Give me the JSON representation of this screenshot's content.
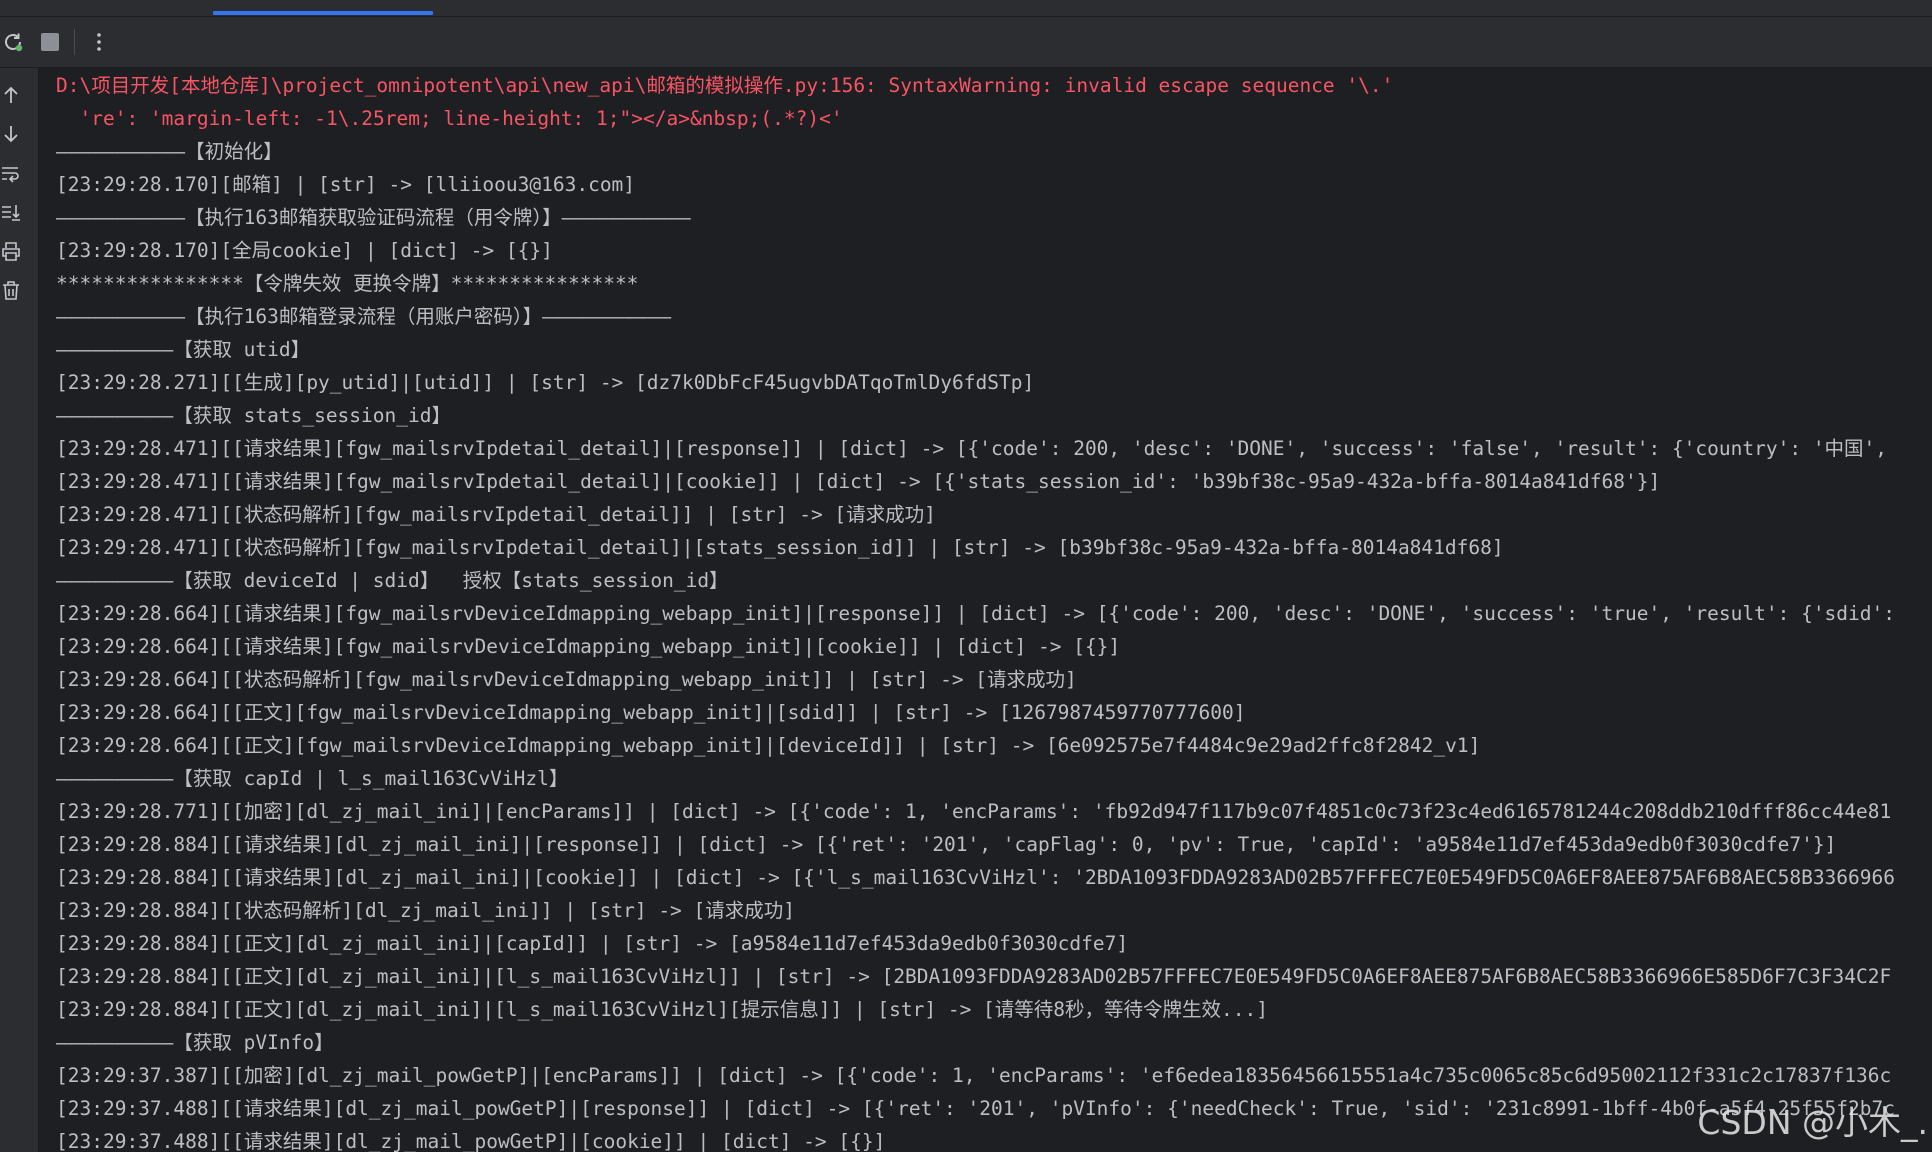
{
  "toolbar": {
    "rerun_icon": "rerun-icon",
    "stop_icon": "stop-icon",
    "more_icon": "more-vertical-icon"
  },
  "gutter": {
    "up_icon": "arrow-up-icon",
    "down_icon": "arrow-down-icon",
    "wrap_icon": "soft-wrap-icon",
    "scroll_end_icon": "scroll-to-end-icon",
    "print_icon": "print-icon",
    "clear_icon": "trash-icon"
  },
  "colors": {
    "background": "#1e1f22",
    "panel": "#2b2d30",
    "text": "#bcbec4",
    "error": "#f75464",
    "accent": "#3574f0"
  },
  "console_lines": [
    {
      "text": "D:\\项目开发[本地仓库]\\project_omnipotent\\api\\new_api\\邮箱的模拟操作.py:156: SyntaxWarning: invalid escape sequence '\\.'",
      "type": "err"
    },
    {
      "text": "  're': 'margin-left: -1\\.25rem; line-height: 1;\"></a>&nbsp;(.*?)<'",
      "type": "err"
    },
    {
      "text": "———————————【初始化】",
      "type": "normal"
    },
    {
      "text": "[23:29:28.170][邮箱] | [str] -> [lliioou3@163.com]",
      "type": "normal"
    },
    {
      "text": "———————————【执行163邮箱获取验证码流程（用令牌）】———————————",
      "type": "normal"
    },
    {
      "text": "[23:29:28.170][全局cookie] | [dict] -> [{}]",
      "type": "normal"
    },
    {
      "text": "****************【令牌失效 更换令牌】****************",
      "type": "normal"
    },
    {
      "text": "———————————【执行163邮箱登录流程（用账户密码）】———————————",
      "type": "normal"
    },
    {
      "text": "——————————【获取 utid】",
      "type": "normal"
    },
    {
      "text": "[23:29:28.271][[生成][py_utid]|[utid]] | [str] -> [dz7k0DbFcF45ugvbDATqoTmlDy6fdSTp]",
      "type": "normal"
    },
    {
      "text": "——————————【获取 stats_session_id】",
      "type": "normal"
    },
    {
      "text": "[23:29:28.471][[请求结果][fgw_mailsrvIpdetail_detail]|[response]] | [dict] -> [{'code': 200, 'desc': 'DONE', 'success': 'false', 'result': {'country': '中国',",
      "type": "normal"
    },
    {
      "text": "[23:29:28.471][[请求结果][fgw_mailsrvIpdetail_detail]|[cookie]] | [dict] -> [{'stats_session_id': 'b39bf38c-95a9-432a-bffa-8014a841df68'}]",
      "type": "normal"
    },
    {
      "text": "[23:29:28.471][[状态码解析][fgw_mailsrvIpdetail_detail]] | [str] -> [请求成功]",
      "type": "normal"
    },
    {
      "text": "[23:29:28.471][[状态码解析][fgw_mailsrvIpdetail_detail]|[stats_session_id]] | [str] -> [b39bf38c-95a9-432a-bffa-8014a841df68]",
      "type": "normal"
    },
    {
      "text": "——————————【获取 deviceId | sdid】  授权【stats_session_id】",
      "type": "normal"
    },
    {
      "text": "[23:29:28.664][[请求结果][fgw_mailsrvDeviceIdmapping_webapp_init]|[response]] | [dict] -> [{'code': 200, 'desc': 'DONE', 'success': 'true', 'result': {'sdid':",
      "type": "normal"
    },
    {
      "text": "[23:29:28.664][[请求结果][fgw_mailsrvDeviceIdmapping_webapp_init]|[cookie]] | [dict] -> [{}]",
      "type": "normal"
    },
    {
      "text": "[23:29:28.664][[状态码解析][fgw_mailsrvDeviceIdmapping_webapp_init]] | [str] -> [请求成功]",
      "type": "normal"
    },
    {
      "text": "[23:29:28.664][[正文][fgw_mailsrvDeviceIdmapping_webapp_init]|[sdid]] | [str] -> [1267987459770777600]",
      "type": "normal"
    },
    {
      "text": "[23:29:28.664][[正文][fgw_mailsrvDeviceIdmapping_webapp_init]|[deviceId]] | [str] -> [6e092575e7f4484c9e29ad2ffc8f2842_v1]",
      "type": "normal"
    },
    {
      "text": "——————————【获取 capId | l_s_mail163CvViHzl】",
      "type": "normal"
    },
    {
      "text": "[23:29:28.771][[加密][dl_zj_mail_ini]|[encParams]] | [dict] -> [{'code': 1, 'encParams': 'fb92d947f117b9c07f4851c0c73f23c4ed6165781244c208ddb210dfff86cc44e81",
      "type": "normal"
    },
    {
      "text": "[23:29:28.884][[请求结果][dl_zj_mail_ini]|[response]] | [dict] -> [{'ret': '201', 'capFlag': 0, 'pv': True, 'capId': 'a9584e11d7ef453da9edb0f3030cdfe7'}]",
      "type": "normal"
    },
    {
      "text": "[23:29:28.884][[请求结果][dl_zj_mail_ini]|[cookie]] | [dict] -> [{'l_s_mail163CvViHzl': '2BDA1093FDDA9283AD02B57FFFEC7E0E549FD5C0A6EF8AEE875AF6B8AEC58B3366966",
      "type": "normal"
    },
    {
      "text": "[23:29:28.884][[状态码解析][dl_zj_mail_ini]] | [str] -> [请求成功]",
      "type": "normal"
    },
    {
      "text": "[23:29:28.884][[正文][dl_zj_mail_ini]|[capId]] | [str] -> [a9584e11d7ef453da9edb0f3030cdfe7]",
      "type": "normal"
    },
    {
      "text": "[23:29:28.884][[正文][dl_zj_mail_ini]|[l_s_mail163CvViHzl]] | [str] -> [2BDA1093FDDA9283AD02B57FFFEC7E0E549FD5C0A6EF8AEE875AF6B8AEC58B3366966E585D6F7C3F34C2F",
      "type": "normal"
    },
    {
      "text": "[23:29:28.884][[正文][dl_zj_mail_ini]|[l_s_mail163CvViHzl][提示信息]] | [str] -> [请等待8秒，等待令牌生效...]",
      "type": "normal"
    },
    {
      "text": "——————————【获取 pVInfo】",
      "type": "normal"
    },
    {
      "text": "[23:29:37.387][[加密][dl_zj_mail_powGetP]|[encParams]] | [dict] -> [{'code': 1, 'encParams': 'ef6edea18356456615551a4c735c0065c85c6d95002112f331c2c17837f136c",
      "type": "normal"
    },
    {
      "text": "[23:29:37.488][[请求结果][dl_zj_mail_powGetP]|[response]] | [dict] -> [{'ret': '201', 'pVInfo': {'needCheck': True, 'sid': '231c8991-1bff-4b0f-a5f4-25f55f2b7c",
      "type": "normal"
    },
    {
      "text": "[23:29:37.488][[请求结果][dl_zj_mail_powGetP]|[cookie]] | [dict] -> [{}]",
      "type": "normal"
    }
  ],
  "watermark": {
    "text": "CSDN @小木_."
  }
}
